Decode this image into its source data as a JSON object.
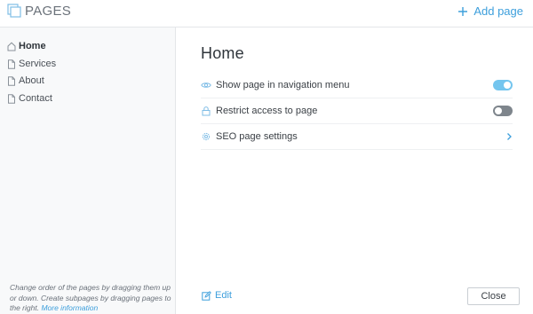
{
  "header": {
    "title": "PAGES",
    "add_page_label": "Add page",
    "logo_icon": "pages-icon",
    "add_icon": "plus-icon"
  },
  "sidebar": {
    "items": [
      {
        "label": "Home",
        "icon": "home-icon",
        "active": true
      },
      {
        "label": "Services",
        "icon": "page-icon",
        "active": false
      },
      {
        "label": "About",
        "icon": "page-icon",
        "active": false
      },
      {
        "label": "Contact",
        "icon": "page-icon",
        "active": false
      }
    ],
    "hint_text": "Change order of the pages by dragging them up or down. Create subpages by dragging pages to the right.",
    "hint_link": "More information"
  },
  "main": {
    "title": "Home",
    "settings": [
      {
        "label": "Show page in navigation menu",
        "icon": "eye-icon",
        "control": "toggle",
        "on": true
      },
      {
        "label": "Restrict access to page",
        "icon": "lock-icon",
        "control": "toggle",
        "on": false
      },
      {
        "label": "SEO page settings",
        "icon": "gear-icon",
        "control": "chevron"
      }
    ],
    "edit_label": "Edit",
    "close_label": "Close"
  },
  "colors": {
    "accent": "#3d9fdc",
    "toggle_on": "#74c5ee",
    "toggle_off": "#7e858c",
    "sidebar_bg": "#f8f9fa"
  }
}
